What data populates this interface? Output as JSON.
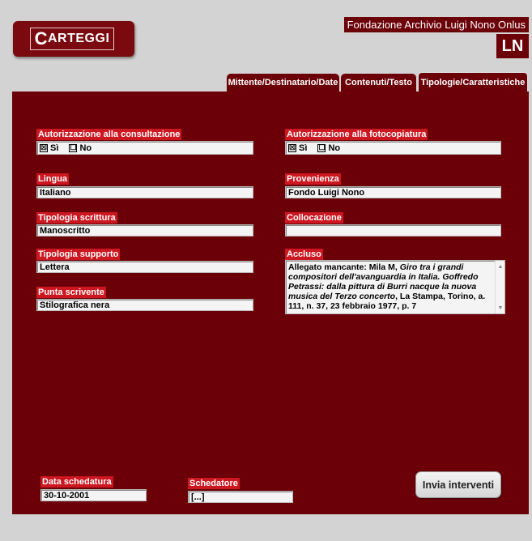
{
  "header": {
    "logo_label": "Carteggi",
    "foundation": "Fondazione Archivio Luigi Nono Onlus",
    "badge": "LN"
  },
  "tabs": [
    {
      "label": "Mittente/Destinatario/Date",
      "active": false
    },
    {
      "label": "Contenuti/Testo",
      "active": false
    },
    {
      "label": "Tipologie/Caratteristiche",
      "active": true
    }
  ],
  "fields": {
    "consultazione": {
      "label": "Autorizzazione alla consultazione",
      "options": [
        {
          "mark": "☒",
          "label": "Sì",
          "checked": true
        },
        {
          "mark": "☐",
          "label": "No",
          "checked": false
        }
      ]
    },
    "fotocopiatura": {
      "label": "Autorizzazione alla fotocopiatura",
      "options": [
        {
          "mark": "☒",
          "label": "Sì",
          "checked": true
        },
        {
          "mark": "☐",
          "label": "No",
          "checked": false
        }
      ]
    },
    "lingua": {
      "label": "Lingua",
      "value": "Italiano"
    },
    "provenienza": {
      "label": "Provenienza",
      "value": "Fondo Luigi Nono"
    },
    "tipologia_scrittura": {
      "label": "Tipologia scrittura",
      "value": "Manoscritto"
    },
    "collocazione": {
      "label": "Collocazione",
      "value": ""
    },
    "tipologia_supporto": {
      "label": "Tipologia supporto",
      "value": "Lettera"
    },
    "accluso": {
      "label": "Accluso",
      "segments": [
        {
          "text": "Allegato mancante: Mila M, ",
          "italic": false
        },
        {
          "text": "Giro tra i grandi compositori dell'avanguardia in Italia. Goffredo Petrassi: dalla pittura di Burri nacque la nuova musica del Terzo concerto",
          "italic": true
        },
        {
          "text": ", La Stampa, Torino, a. 111, n. 37, 23 febbraio 1977, p. 7",
          "italic": false
        }
      ]
    },
    "punta_scrivente": {
      "label": "Punta scrivente",
      "value": "Stilografica nera"
    },
    "data_schedatura": {
      "label": "Data schedatura",
      "value": "30-10-2001"
    },
    "schedatore": {
      "label": "Schedatore",
      "value": "[...]"
    }
  },
  "buttons": {
    "send": "Invia interventi"
  },
  "colors": {
    "panel": "#6b0008",
    "label_bg": "#cc1620",
    "page_bg": "#d3d3d3"
  }
}
